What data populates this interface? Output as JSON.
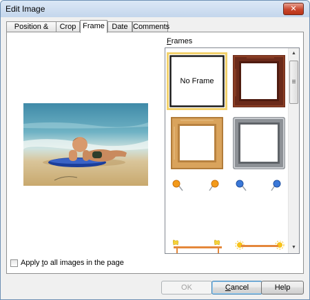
{
  "window": {
    "title": "Edit Image",
    "close_glyph": "✕"
  },
  "tabs": [
    {
      "label": "Position & Size",
      "active": false
    },
    {
      "label": "Crop",
      "active": false
    },
    {
      "label": "Frame",
      "active": true
    },
    {
      "label": "Date",
      "active": false
    },
    {
      "label": "Comments",
      "active": false
    }
  ],
  "frames": {
    "label_underlined": "F",
    "label_rest": "rames",
    "items": [
      {
        "name": "no-frame",
        "label": "No Frame",
        "selected": true
      },
      {
        "name": "dark-wood-frame",
        "label": "",
        "selected": false
      },
      {
        "name": "light-wood-frame",
        "label": "",
        "selected": false
      },
      {
        "name": "silver-frame",
        "label": "",
        "selected": false
      },
      {
        "name": "orange-pushpins",
        "label": "",
        "selected": false
      },
      {
        "name": "blue-pushpins",
        "label": "",
        "selected": false
      },
      {
        "name": "butterfly-bar",
        "label": "",
        "selected": false
      },
      {
        "name": "sun-bar",
        "label": "",
        "selected": false
      }
    ]
  },
  "apply_all": {
    "label_pre": "Apply ",
    "label_underlined": "t",
    "label_post": "o all images in the page",
    "checked": false
  },
  "buttons": {
    "ok": "OK",
    "cancel": "Cancel",
    "cancel_underlined": "C",
    "cancel_rest": "ancel",
    "help": "Help"
  },
  "colors": {
    "selection_border": "#f2d16b",
    "dark_wood": "#6b2a1a",
    "light_wood": "#d9a35c",
    "silver": "#8d9196",
    "scrollbar_track": "#f0f0f0"
  },
  "icons": {
    "close": "close-icon",
    "scroll_up": "scroll-up-icon",
    "scroll_down": "scroll-down-icon"
  }
}
